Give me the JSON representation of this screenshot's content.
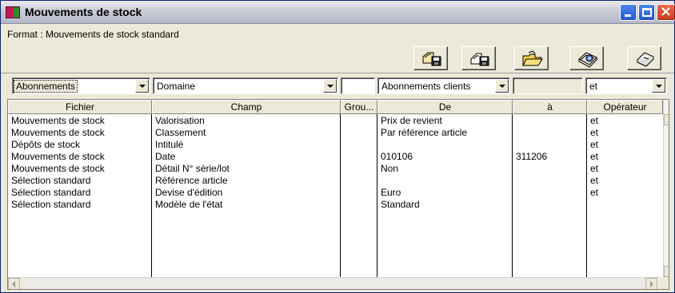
{
  "window": {
    "title": "Mouvements de stock"
  },
  "format": {
    "label": "Format : Mouvements de stock standard"
  },
  "toolbar": [
    {
      "icon": "save-format-icon"
    },
    {
      "icon": "save-as-format-icon"
    },
    {
      "icon": "open-format-icon"
    },
    {
      "icon": "print-settings-icon"
    },
    {
      "icon": "erase-icon"
    }
  ],
  "filters": {
    "type": "Abonnements",
    "domain": "Domaine",
    "group": "",
    "from": "Abonnements clients",
    "to": "",
    "operator": "et"
  },
  "table": {
    "columns": [
      "Fichier",
      "Champ",
      "Grou...",
      "De",
      "à",
      "Opérateur"
    ],
    "rows": [
      [
        "Mouvements de stock",
        "Valorisation",
        "",
        "Prix de revient",
        "",
        "et"
      ],
      [
        "Mouvements de stock",
        "Classement",
        "",
        "Par référence article",
        "",
        "et"
      ],
      [
        "Dépôts de stock",
        "Intitulé",
        "",
        "",
        "",
        "et"
      ],
      [
        "Mouvements de stock",
        "Date",
        "",
        "010106",
        "311206",
        "et"
      ],
      [
        "Mouvements de stock",
        "Détail N° série/lot",
        "",
        "Non",
        "",
        "et"
      ],
      [
        "Sélection standard",
        "Référence article",
        "",
        "",
        "",
        "et"
      ],
      [
        "Sélection standard",
        "Devise d'édition",
        "",
        "Euro",
        "",
        "et"
      ],
      [
        "Sélection standard",
        "Modèle de l'état",
        "",
        "Standard",
        "",
        ""
      ]
    ]
  },
  "colors": {
    "title_bar": "#c9cbd6",
    "window_face": "#ece9d8",
    "close_button": "#cf3a1c",
    "min_max_button": "#2459d4"
  }
}
